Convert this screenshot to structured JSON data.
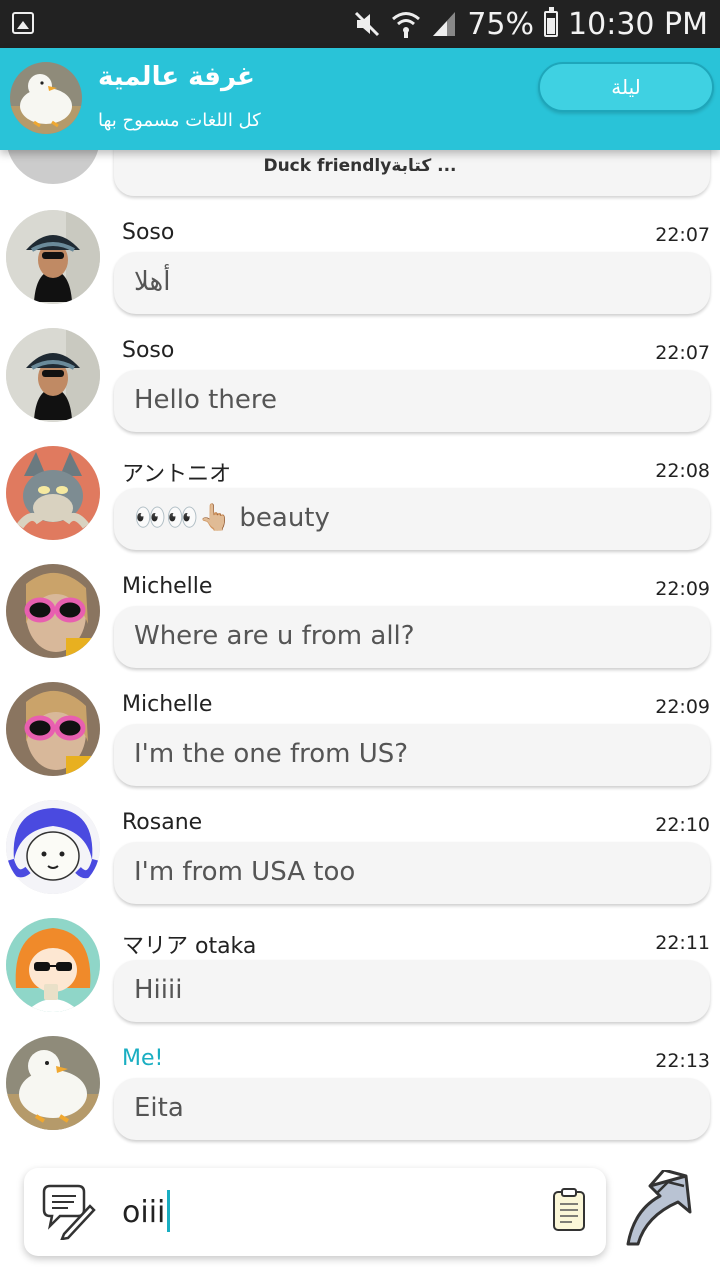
{
  "status_bar": {
    "battery": "75%",
    "time": "10:30 PM",
    "icons": [
      "image-notification-icon",
      "mute-icon",
      "wifi-icon",
      "signal-icon",
      "battery-icon"
    ]
  },
  "header": {
    "title": "غرفة عالمية",
    "subtitle": "كل اللغات مسموح بها",
    "night_button": "ليلة"
  },
  "typing_indicator": "Duck friendlyكتابة ...",
  "messages": [
    {
      "sender": "Soso",
      "time": "22:07",
      "text": "أهلا",
      "avatar": "girl-bucket-hat"
    },
    {
      "sender": "Soso",
      "time": "22:07",
      "text": "Hello there",
      "avatar": "girl-bucket-hat"
    },
    {
      "sender": "アントニオ",
      "time": "22:08",
      "text": "👀👀👆🏼 beauty",
      "avatar": "cartoon-cat"
    },
    {
      "sender": "Michelle",
      "time": "22:09",
      "text": "Where are u from all?",
      "avatar": "girl-pink-glasses"
    },
    {
      "sender": "Michelle",
      "time": "22:09",
      "text": "I'm the one from US?",
      "avatar": "girl-pink-glasses"
    },
    {
      "sender": "Rosane",
      "time": "22:10",
      "text": "I'm from USA too",
      "avatar": "anime-blue-hair"
    },
    {
      "sender": "マリア otaka",
      "time": "22:11",
      "text": "Hiiii",
      "avatar": "anime-sunglasses"
    },
    {
      "sender": "Me!",
      "time": "22:13",
      "text": "Eita",
      "avatar": "duck"
    }
  ],
  "composer": {
    "value": "oiii",
    "icons": [
      "compose-icon",
      "document-icon",
      "send-arrow-icon"
    ]
  },
  "colors": {
    "header": "#29c3d8",
    "accent": "#1aaec2",
    "bubble": "#f5f5f5"
  }
}
